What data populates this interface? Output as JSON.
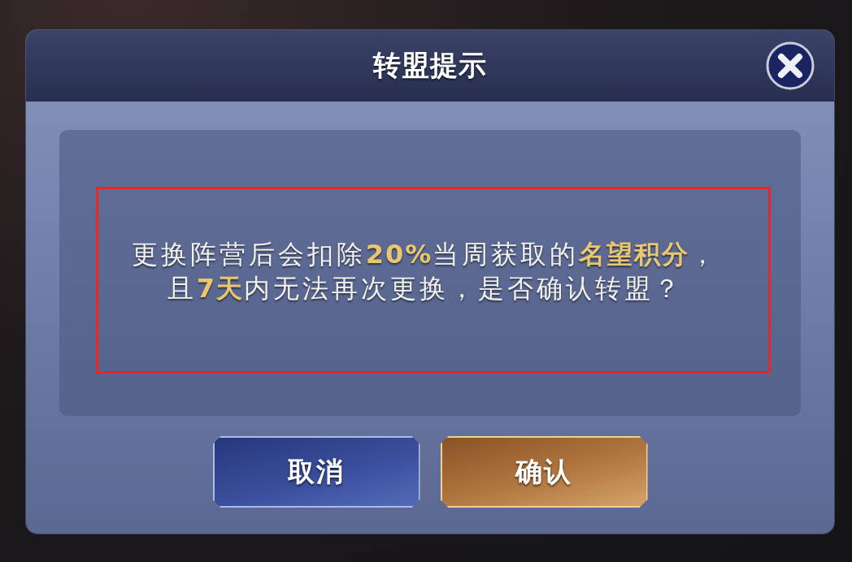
{
  "dialog": {
    "title": "转盟提示",
    "message": {
      "text": "更换阵营后会扣除**20%**当周获取的**名望积分**，且**7天**内无法再次更换，是否确认转盟？",
      "highlighted": true
    },
    "buttons": [
      {
        "label": "取消",
        "kind": "secondary"
      },
      {
        "label": "确认",
        "kind": "primary"
      }
    ]
  }
}
